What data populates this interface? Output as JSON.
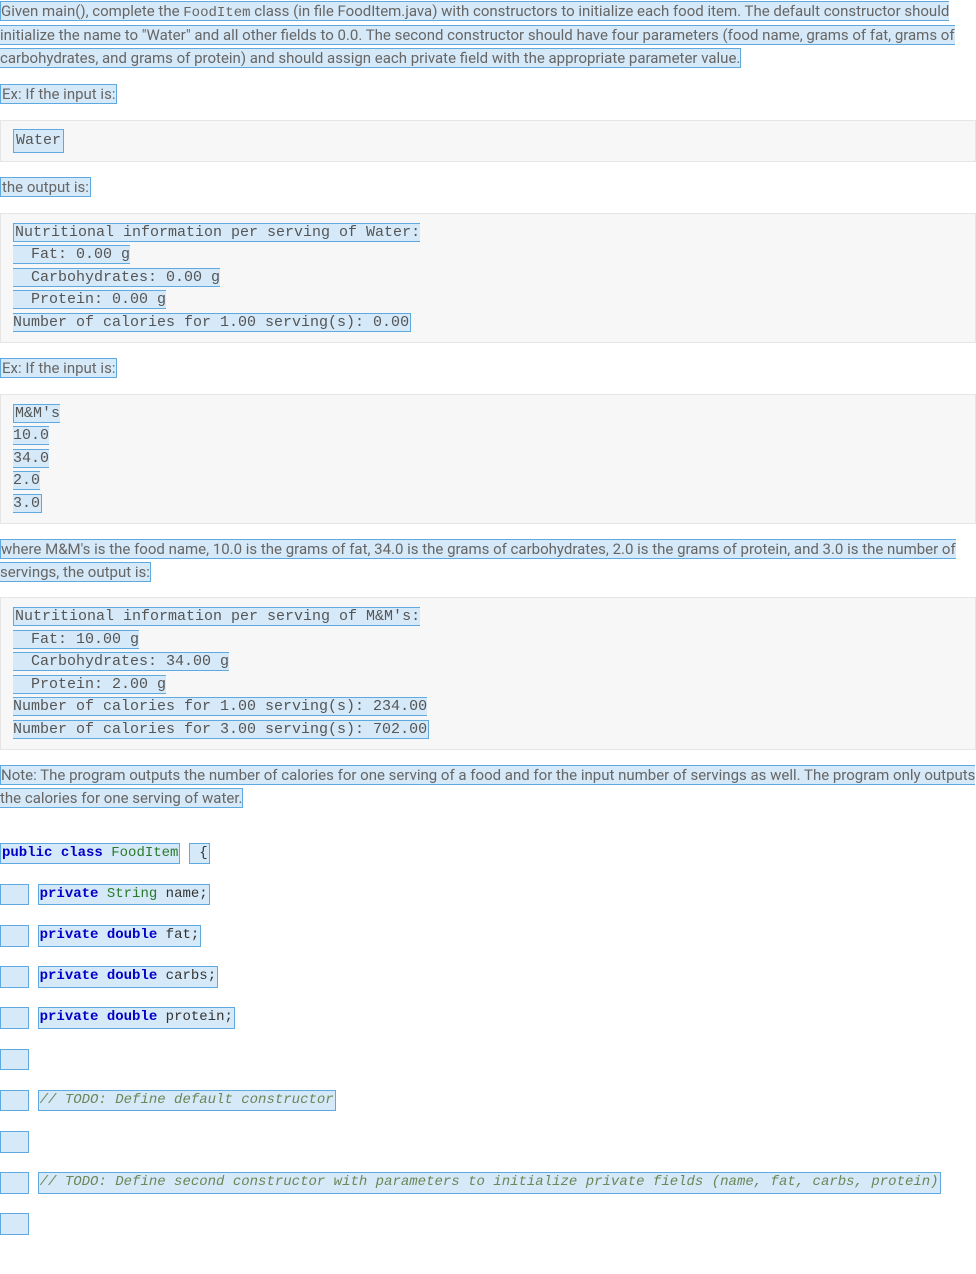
{
  "intro": {
    "p1_a": "Given main(), complete the ",
    "p1_code": "FoodItem",
    "p1_b": " class (in file FoodItem.java) with constructors to initialize each food item. The default constructor should initialize the name to \"Water\" and all other fields to 0.0. The second constructor should have four parameters (food name, grams of fat, grams of carbohydrates, and grams of protein) and should assign each private field with the appropriate parameter value."
  },
  "ex1_label": "Ex: If the input is:",
  "ex1_input": "Water",
  "output_label": "the output is:",
  "ex1_output": "Nutritional information per serving of Water:\n  Fat: 0.00 g\n  Carbohydrates: 0.00 g\n  Protein: 0.00 g\nNumber of calories for 1.00 serving(s): 0.00",
  "ex2_label": "Ex: If the input is:",
  "ex2_input": "M&M's\n10.0\n34.0\n2.0\n3.0",
  "ex2_explain": "where M&M's is the food name, 10.0 is the grams of fat, 34.0 is the grams of carbohydrates, 2.0 is the grams of protein, and 3.0 is the number of servings, the output is:",
  "ex2_output": "Nutritional information per serving of M&M's:\n  Fat: 10.00 g\n  Carbohydrates: 34.00 g\n  Protein: 2.00 g\nNumber of calories for 1.00 serving(s): 234.00\nNumber of calories for 3.00 serving(s): 702.00",
  "note": "Note: The program outputs the number of calories for one serving of a food and for the input number of servings as well. The program only outputs the calories for one serving of water.",
  "java": {
    "l1": {
      "kw1": "public",
      "kw2": "class",
      "cls": "FoodItem",
      "rest": " {"
    },
    "l2": {
      "kw": "private",
      "type": "String",
      "name": "name",
      "semi": ";"
    },
    "l3": {
      "kw": "private",
      "type": "double",
      "name": "fat",
      "semi": ";"
    },
    "l4": {
      "kw": "private",
      "type": "double",
      "name": "carbs",
      "semi": ";"
    },
    "l5": {
      "kw": "private",
      "type": "double",
      "name": "protein",
      "semi": ";"
    },
    "l7": "// TODO: Define default constructor",
    "l9": "// TODO: Define second constructor with parameters to initialize private fields (name, fat, carbs, protein)"
  }
}
